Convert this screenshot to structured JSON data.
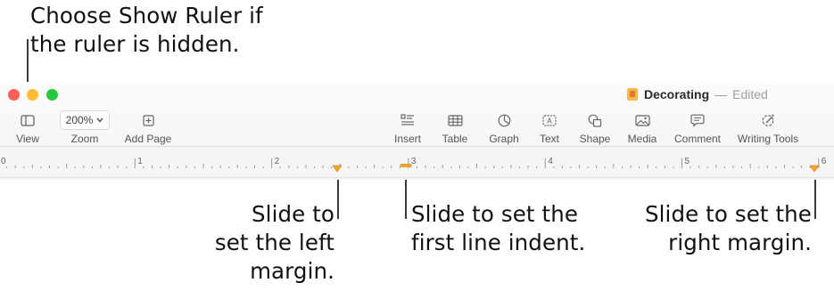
{
  "callouts": {
    "top": [
      "Choose Show Ruler if",
      "the ruler is hidden."
    ],
    "left_margin": [
      "Slide to",
      "set the left",
      "margin."
    ],
    "first_indent": [
      "Slide to set the",
      "first line indent."
    ],
    "right_margin": [
      "Slide to set the",
      "right margin."
    ]
  },
  "window": {
    "doc_title": "Decorating",
    "separator": "—",
    "status": "Edited"
  },
  "toolbar": {
    "view": "View",
    "zoom_value": "200%",
    "zoom": "Zoom",
    "add_page": "Add Page",
    "insert": "Insert",
    "table": "Table",
    "graph": "Graph",
    "text": "Text",
    "shape": "Shape",
    "media": "Media",
    "comment": "Comment",
    "writing_tools": "Writing Tools"
  },
  "ruler": {
    "numbers": [
      "0",
      "1",
      "2",
      "3",
      "4",
      "5",
      "6"
    ],
    "marker_color": "#f5a623"
  }
}
